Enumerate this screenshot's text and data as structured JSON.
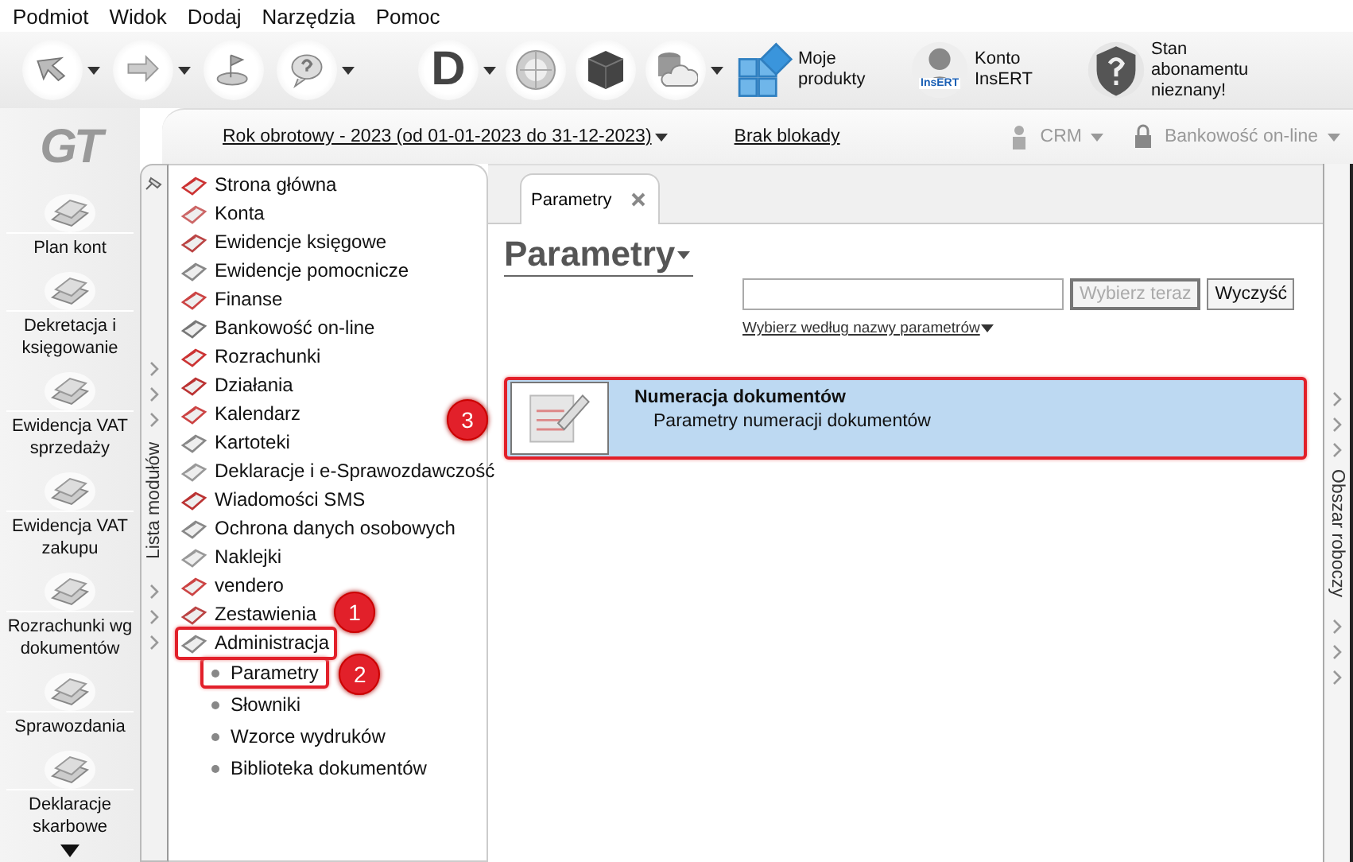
{
  "menu": [
    "Podmiot",
    "Widok",
    "Dodaj",
    "Narzędzia",
    "Pomoc"
  ],
  "toolbar": {
    "left_buttons": [
      {
        "dropdown": true
      },
      {
        "dropdown": true
      },
      {
        "dropdown": false
      },
      {
        "dropdown": true
      }
    ],
    "right_buttons": [
      {
        "kind": "letter",
        "glyph": "D",
        "dropdown": true
      },
      {
        "kind": "icon",
        "dropdown": false
      },
      {
        "kind": "icon",
        "dropdown": false
      },
      {
        "kind": "icon",
        "dropdown": true
      },
      {
        "kind": "labeled",
        "label": "Moje produkty"
      },
      {
        "kind": "labeled",
        "label": "Konto InsERT",
        "badge": "InsERT"
      },
      {
        "kind": "labeled",
        "label": "Stan abonamentu nieznany!"
      }
    ]
  },
  "logo": "GT",
  "context_bar": {
    "fiscal_year": "Rok obrotowy - 2023  (od 01-01-2023 do 31-12-2023)",
    "lock_status": "Brak blokady",
    "crm": {
      "label": "CRM",
      "disabled": true
    },
    "banking": {
      "label": "Bankowość on-line",
      "disabled": true
    }
  },
  "shortcuts": [
    "Plan kont",
    "Dekretacja i księgowanie",
    "Ewidencja VAT sprzedaży",
    "Ewidencja VAT zakupu",
    "Rozrachunki wg dokumentów",
    "Sprawozdania",
    "Deklaracje skarbowe"
  ],
  "modules": {
    "title": "Lista modułów",
    "items": [
      {
        "label": "Strona główna",
        "highlighted": false
      },
      {
        "label": "Konta",
        "highlighted": false
      },
      {
        "label": "Ewidencje księgowe",
        "highlighted": false
      },
      {
        "label": "Ewidencje pomocnicze",
        "highlighted": false
      },
      {
        "label": "Finanse",
        "highlighted": false
      },
      {
        "label": "Bankowość on-line",
        "highlighted": false
      },
      {
        "label": "Rozrachunki",
        "highlighted": false
      },
      {
        "label": "Działania",
        "highlighted": false
      },
      {
        "label": "Kalendarz",
        "highlighted": false
      },
      {
        "label": "Kartoteki",
        "highlighted": false
      },
      {
        "label": "Deklaracje i e-Sprawozdawczość",
        "highlighted": false
      },
      {
        "label": "Wiadomości SMS",
        "highlighted": false
      },
      {
        "label": "Ochrona danych osobowych",
        "highlighted": false
      },
      {
        "label": "Naklejki",
        "highlighted": false
      },
      {
        "label": "vendero",
        "highlighted": false
      },
      {
        "label": "Zestawienia",
        "highlighted": false
      },
      {
        "label": "Administracja",
        "highlighted": true,
        "expanded": true,
        "children": [
          {
            "label": "Parametry",
            "highlighted": true
          },
          {
            "label": "Słowniki",
            "highlighted": false
          },
          {
            "label": "Wzorce wydruków",
            "highlighted": false
          },
          {
            "label": "Biblioteka dokumentów",
            "highlighted": false
          }
        ]
      }
    ]
  },
  "tabs": [
    {
      "label": "Parametry",
      "selected": true
    }
  ],
  "page": {
    "title": "Parametry",
    "buttons": [
      {
        "label": "Wybierz teraz",
        "disabled": true
      },
      {
        "label": "Wyczyść",
        "disabled": false
      }
    ],
    "filter_link": "Wybierz według nazwy parametrów",
    "results": [
      {
        "title": "Numeracja dokumentów",
        "description": "Parametry numeracji dokumentów",
        "selected": true,
        "highlighted": true
      }
    ]
  },
  "workspace_panel": {
    "title": "Obszar roboczy"
  },
  "annotations": [
    {
      "number": "1"
    },
    {
      "number": "2"
    },
    {
      "number": "3"
    }
  ]
}
